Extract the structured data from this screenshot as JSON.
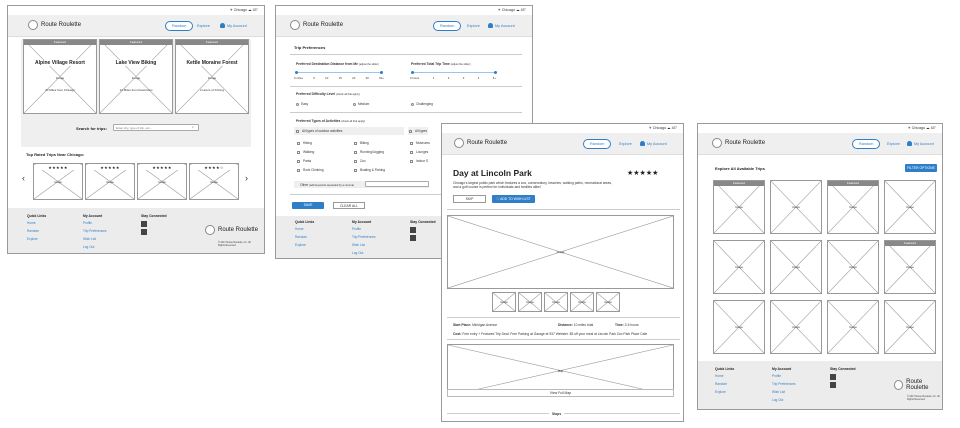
{
  "status": {
    "location": "Chicago",
    "temp": "43°"
  },
  "brand": "Route Roulette",
  "nav": {
    "random": "Random",
    "explore": "Explore",
    "account": "My Account"
  },
  "home": {
    "featured": [
      {
        "band": "Featured",
        "title": "Alpine Village Resort",
        "image": "Image",
        "detail": "30 Miles from Chicago"
      },
      {
        "band": "Featured",
        "title": "Lake View Biking",
        "image": "Image",
        "detail": "12 Miles from Downtown"
      },
      {
        "band": "Featured",
        "title": "Kettle Moraine Forest",
        "image": "Image",
        "detail": "2 Hours of Driving"
      }
    ],
    "search_label": "Search for trips:",
    "search_placeholder": "Enter city, type of trip, etc...",
    "top_rated": "Top Rated Trips Near Chicago:",
    "carousel": [
      {
        "stars": "★★★★★",
        "image": "Image"
      },
      {
        "stars": "★★★★★",
        "image": "Image"
      },
      {
        "stars": "★★★★★",
        "image": "Image"
      },
      {
        "stars": "★★★★☆",
        "image": "Image"
      }
    ]
  },
  "footer": {
    "quick_links": "Quick Links",
    "quick": [
      "Home",
      "Random",
      "Explore"
    ],
    "my_account": "My Account",
    "account": [
      "Profile",
      "Trip Preferences",
      "Wish List",
      "Log Out"
    ],
    "stay_connected": "Stay Connected",
    "copyright": "© 2017 Route Roulette, Inc. All Rights Reserved."
  },
  "prefs": {
    "heading": "Trip Preferences",
    "distance_label": "Preferred Destination Distance from Me",
    "distance_hint": "(adjust the slider)",
    "distance_ticks": [
      "0 miles",
      "5",
      "10",
      "15",
      "20",
      "30",
      "50+"
    ],
    "time_label": "Preferred Total Trip Time",
    "time_hint": "(adjust the slider)",
    "time_ticks": [
      "0 hours",
      "1",
      "2",
      "3",
      "4",
      "5+"
    ],
    "difficulty_label": "Preferred Difficulty Level",
    "difficulty_hint": "(check all that apply)",
    "difficulty": [
      "Easy",
      "Medium",
      "Challenging"
    ],
    "types_label": "Preferred Types of Activities",
    "types_hint": "(check all that apply)",
    "outdoor_all": "All types of outdoor activities",
    "indoor_all": "All types",
    "outdoor": [
      "Hiking",
      "Biking",
      "Walking",
      "Running/Jogging",
      "Parks",
      "Zoo",
      "Rock Climbing",
      "Boating & Fishing"
    ],
    "indoor": [
      "Museums",
      "Lounges",
      "Indoor S"
    ],
    "other": "Other",
    "other_hint": "(add keywords separated by a comma)",
    "save": "SAVE",
    "clear": "CLEAR ALL"
  },
  "detail": {
    "title": "Day at Lincoln Park",
    "stars": "★★★★★",
    "desc": "Chicago's largest public park which features a zoo, conservatory, beaches, walking paths, recreational areas, and a golf course is perfect for individuals and families alike!",
    "skip": "SKIP",
    "wish": "ADD TO WISH LIST",
    "image": "Image",
    "thumbs": [
      "Image",
      "Image",
      "Image",
      "Image",
      "Image"
    ],
    "start_label": "Start Place:",
    "start_value": "Michigan Avenue",
    "distance_label": "Distance:",
    "distance_value": "10 miles total",
    "time_label": "Time:",
    "time_value": "3-5 hours",
    "cost_label": "Cost:",
    "cost_value": "Free entry",
    "cost_extra": "+ Featured Trip Deal: Free Parking at Garage at 937 Webster. $5 off your meal at Lincoln Park Zoo Park Place Cafe",
    "map": "Map",
    "map_link": "View Full Map",
    "stops": "Stops"
  },
  "explore": {
    "heading": "Explore All Available Trips",
    "filter": "FILTER OPTIONS",
    "grid": [
      {
        "band": "Featured",
        "image": "Image"
      },
      {
        "band": "",
        "image": "Image"
      },
      {
        "band": "Featured",
        "image": "Image"
      },
      {
        "band": "",
        "image": "Image"
      },
      {
        "band": "",
        "image": "Image"
      },
      {
        "band": "",
        "image": "Image"
      },
      {
        "band": "",
        "image": "Image"
      },
      {
        "band": "Featured",
        "image": "Image"
      },
      {
        "band": "",
        "image": "Image"
      },
      {
        "band": "",
        "image": "Image"
      },
      {
        "band": "",
        "image": "Image"
      },
      {
        "band": "",
        "image": "Image"
      }
    ]
  }
}
